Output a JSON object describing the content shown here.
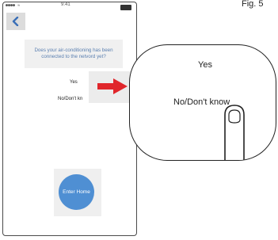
{
  "figure": {
    "label": "Fig. 5"
  },
  "status_bar": {
    "carrier": "●●●● ≈",
    "time": "9:41"
  },
  "question": "Does your air-conditioning has been connected to the netvord yet?",
  "options": {
    "yes": "Yes",
    "no": "No/Don't kn"
  },
  "enter_home": "Enter Home",
  "zoom": {
    "yes": "Yes",
    "no": "No/Don't know"
  },
  "colors": {
    "accent": "#4f8fd3",
    "arrow": "#e0262b",
    "question_text": "#5a7fb0"
  },
  "icons": {
    "back": "chevron-left-icon",
    "pointer": "finger-pointer-icon",
    "arrow": "right-arrow-icon"
  }
}
